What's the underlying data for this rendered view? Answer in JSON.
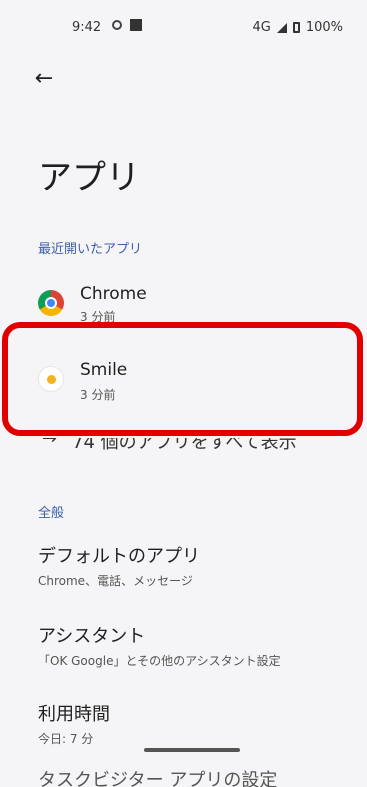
{
  "status_bar": {
    "time": "9:42",
    "network": "4G",
    "battery": "100%"
  },
  "header": {
    "back_icon": "arrow-left-icon",
    "title": "アプリ"
  },
  "recent_section": {
    "header": "最近開いたアプリ",
    "items": [
      {
        "name": "Chrome",
        "time": "3 分前",
        "icon": "chrome-icon"
      },
      {
        "name": "Smile",
        "time": "3 分前",
        "icon": "smile-app-icon"
      }
    ],
    "see_all": "74 個のアプリをすべて表示"
  },
  "general_section": {
    "header": "全般",
    "items": [
      {
        "title": "デフォルトのアプリ",
        "subtitle": "Chrome、電話、メッセージ"
      },
      {
        "title": "アシスタント",
        "subtitle": "「OK Google」とその他のアシスタント設定"
      },
      {
        "title": "利用時間",
        "subtitle": "今日: 7 分"
      }
    ],
    "partial_item": "タスクビジター アプリの設定"
  },
  "colors": {
    "highlight": "#e00000",
    "section_header": "#3b5fa8"
  }
}
